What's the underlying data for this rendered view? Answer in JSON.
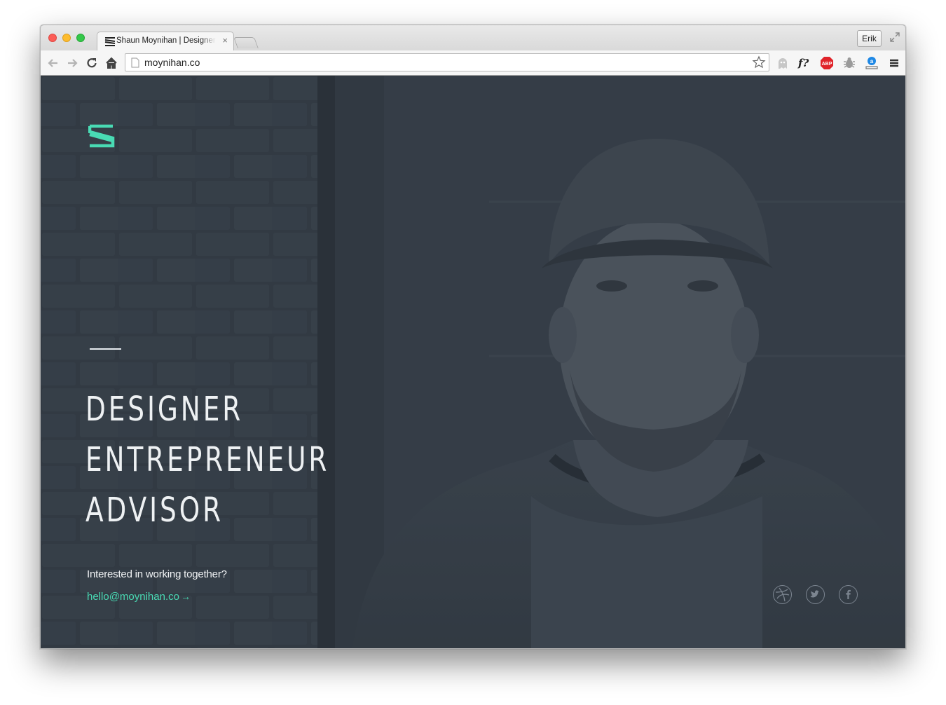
{
  "browser": {
    "tab_title": "Shaun Moynihan | Designer, Entrepreneur, Advisor",
    "tab_close": "×",
    "profile_name": "Erik",
    "url": "moynihan.co",
    "extensions": [
      "ghost-icon",
      "font-icon",
      "adblock-icon",
      "bug-icon",
      "amazon-icon",
      "menu-icon"
    ],
    "extension_labels": {
      "font": "f?",
      "adblock": "ABP"
    }
  },
  "page": {
    "headline": [
      "DESIGNER",
      "ENTREPRENEUR",
      "ADVISOR"
    ],
    "cta_text": "Interested in working together?",
    "cta_email": "hello@moynihan.co",
    "cta_arrow": "→",
    "social": [
      "dribbble-icon",
      "twitter-icon",
      "facebook-icon"
    ],
    "colors": {
      "accent": "#49dbb4",
      "background": "#323b44",
      "text": "#eef1f3"
    }
  }
}
